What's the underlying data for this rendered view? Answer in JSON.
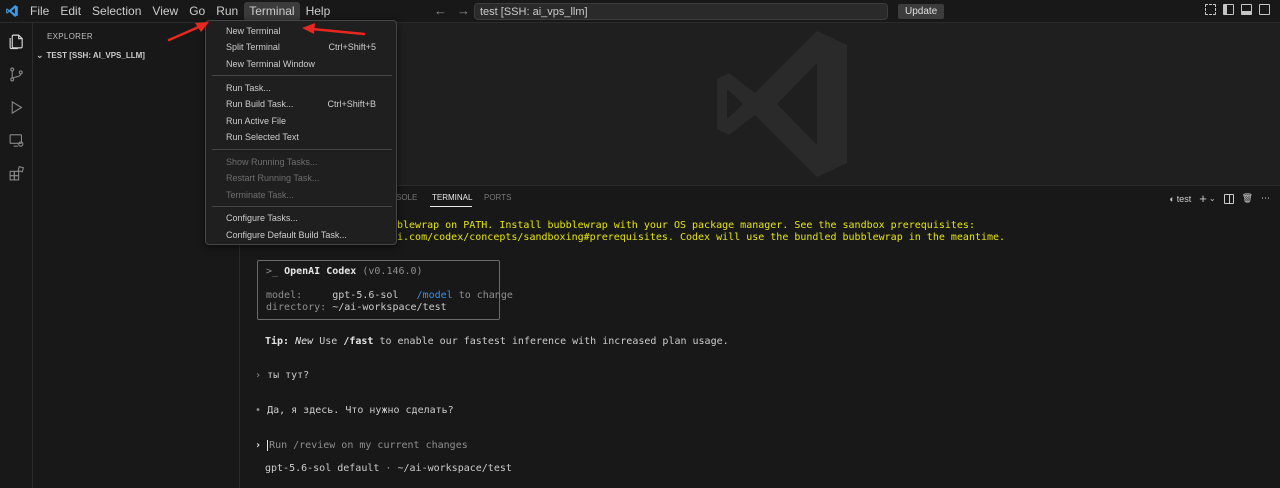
{
  "titlebar": {
    "menus": [
      "File",
      "Edit",
      "Selection",
      "View",
      "Go",
      "Run",
      "Terminal",
      "Help"
    ],
    "active_menu": "Terminal",
    "command_center": "test [SSH: ai_vps_llm]",
    "update_label": "Update",
    "nav_back_icon": "arrow-left-icon",
    "nav_forward_icon": "arrow-right-icon"
  },
  "activitybar": {
    "icons": [
      "files-icon",
      "source-control-icon",
      "run-debug-icon",
      "remote-explorer-icon",
      "extensions-icon"
    ]
  },
  "sidebar": {
    "title": "EXPLORER",
    "root_folder": "TEST [SSH: AI_VPS_LLM]"
  },
  "terminal_menu": {
    "items": [
      {
        "label": "New Terminal",
        "shortcut": ""
      },
      {
        "label": "Split Terminal",
        "shortcut": "Ctrl+Shift+5"
      },
      {
        "label": "New Terminal Window",
        "shortcut": ""
      },
      {
        "label": "Run Task...",
        "shortcut": ""
      },
      {
        "label": "Run Build Task...",
        "shortcut": "Ctrl+Shift+B"
      },
      {
        "label": "Run Active File",
        "shortcut": ""
      },
      {
        "label": "Run Selected Text",
        "shortcut": ""
      },
      {
        "label": "Show Running Tasks...",
        "shortcut": "",
        "disabled": true
      },
      {
        "label": "Restart Running Task...",
        "shortcut": "",
        "disabled": true
      },
      {
        "label": "Terminate Task...",
        "shortcut": "",
        "disabled": true
      },
      {
        "label": "Configure Tasks...",
        "shortcut": ""
      },
      {
        "label": "Configure Default Build Task...",
        "shortcut": ""
      }
    ]
  },
  "panel": {
    "tabs": [
      "SOLE",
      "TERMINAL",
      "PORTS"
    ],
    "active_tab": "TERMINAL",
    "terminal_name": "test",
    "actions": [
      "new-terminal-icon",
      "split-terminal-icon",
      "kill-terminal-icon",
      "more-icon"
    ]
  },
  "terminal": {
    "warning_line1": "blewrap on PATH. Install bubblewrap with your OS package manager. See the sandbox prerequisites:",
    "warning_line2": "i.com/codex/concepts/sandboxing#prerequisites. Codex will use the bundled bubblewrap in the meantime.",
    "codex_prompt_glyph": ">_",
    "codex_title": "OpenAI Codex",
    "codex_version": "(v0.146.0)",
    "model_label": "model:",
    "model_value": "gpt-5.6-sol",
    "model_cmd": "/model",
    "model_hint": "to change",
    "dir_label": "directory:",
    "dir_value": "~/ai-workspace/test",
    "tip_label": "Tip:",
    "tip_new": "New",
    "tip_use": "Use",
    "tip_cmd": "/fast",
    "tip_rest": "to enable our fastest inference with increased plan usage.",
    "user_msg": "ты тут?",
    "assistant_msg": "Да, я здесь. Что нужно сделать?",
    "input_placeholder": "Run /review on my current changes",
    "status_model": "gpt-5.6-sol default",
    "status_sep": "·",
    "status_dir": "~/ai-workspace/test"
  },
  "colors": {
    "warning": "#e5e510",
    "link": "#3b8eea",
    "arrow": "#e8271e"
  }
}
